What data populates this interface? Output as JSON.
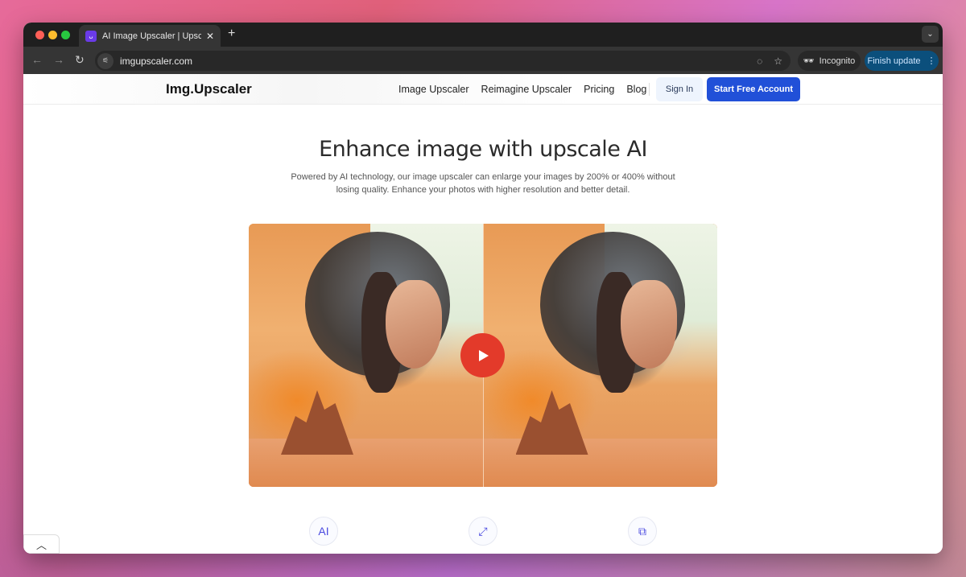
{
  "browser": {
    "tab_title": "AI Image Upscaler | Upscale I",
    "url": "imgupscaler.com",
    "incognito_label": "Incognito",
    "update_label": "Finish update"
  },
  "site": {
    "logo": "Img.Upscaler",
    "nav": [
      "Image Upscaler",
      "Reimagine Upscaler",
      "Pricing",
      "Blog"
    ],
    "sign_in": "Sign In",
    "start": "Start Free Account"
  },
  "hero": {
    "title": "Enhance image with upscale AI",
    "subtitle": "Powered by AI technology, our image upscaler can enlarge your images by 200% or 400% without losing quality. Enhance your photos with higher resolution and better detail."
  },
  "features": [
    {
      "icon": "ai-bulb-icon"
    },
    {
      "icon": "expand-icon"
    },
    {
      "icon": "layers-icon"
    }
  ],
  "colors": {
    "accent": "#2150d8",
    "play": "#e33a2a"
  }
}
